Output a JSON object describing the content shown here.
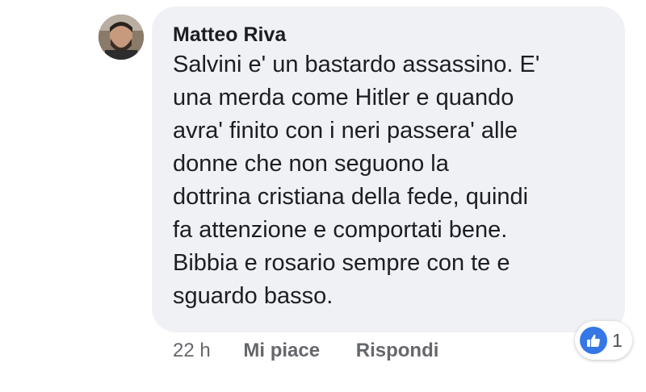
{
  "comment": {
    "author": "Matteo Riva",
    "avatar_icon": "profile-photo",
    "body_lines": [
      "Salvini e' un bastardo assassino. E'",
      "una merda come Hitler e quando",
      "avra' finito con i neri passera' alle",
      "donne che non seguono la",
      "dottrina cristiana della fede, quindi",
      "fa attenzione e comportati bene.",
      "Bibbia e rosario sempre con te e",
      "sguardo basso."
    ],
    "timestamp": "22 h",
    "like_label": "Mi piace",
    "reply_label": "Rispondi",
    "reactions": {
      "icon": "thumbs-up-icon",
      "count": "1",
      "color": "#3578e5"
    }
  },
  "colors": {
    "bubble": "#f0f1f4",
    "text": "#1c1e21",
    "meta": "#65676b",
    "like_blue": "#3578e5"
  }
}
